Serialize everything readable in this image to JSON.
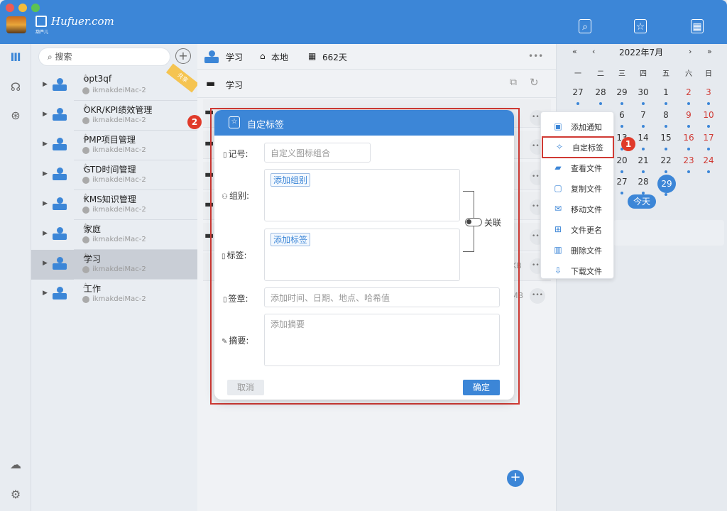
{
  "brand": {
    "logo_text": "Hufuer.com",
    "sub": "葫芦儿"
  },
  "colors": {
    "accent": "#3c86d7",
    "highlight": "#d03a34",
    "weekend": "#d03a34"
  },
  "sidebar": {
    "search_placeholder": "搜索",
    "items": [
      {
        "name": "opt3qf",
        "host": "ikmakdeiMac-2",
        "ribbon": "共享"
      },
      {
        "name": "OKR/KPI绩效管理",
        "host": "ikmakdeiMac-2"
      },
      {
        "name": "PMP项目管理",
        "host": "ikmakdeiMac-2"
      },
      {
        "name": "GTD时间管理",
        "host": "ikmakdeiMac-2"
      },
      {
        "name": "KMS知识管理",
        "host": "ikmakdeiMac-2"
      },
      {
        "name": "家庭",
        "host": "ikmakdeiMac-2"
      },
      {
        "name": "学习",
        "host": "ikmakdeiMac-2"
      },
      {
        "name": "工作",
        "host": "ikmakdeiMac-2"
      }
    ]
  },
  "main": {
    "breadcrumb_db": "学习",
    "breadcrumb_location": "本地",
    "breadcrumb_days": "662天",
    "folder_name": "学习",
    "row_sizes": [
      "KB",
      "MB"
    ]
  },
  "calendar": {
    "title": "2022年7月",
    "weekdays": [
      "一",
      "二",
      "三",
      "四",
      "五",
      "六",
      "日"
    ],
    "today_label": "今天",
    "visible_days": [
      "27",
      "28",
      "29",
      "30",
      "1",
      "2",
      "3",
      "6",
      "7",
      "8",
      "9",
      "10",
      "13",
      "14",
      "15",
      "16",
      "17",
      "20",
      "21",
      "22",
      "23",
      "24",
      "27",
      "28",
      "29",
      "30",
      "31"
    ]
  },
  "context_menu": [
    {
      "icon": "bell-icon",
      "label": "添加通知"
    },
    {
      "icon": "tag-icon",
      "label": "自定标签"
    },
    {
      "icon": "folder-open-icon",
      "label": "查看文件"
    },
    {
      "icon": "copy-icon",
      "label": "复制文件"
    },
    {
      "icon": "move-icon",
      "label": "移动文件"
    },
    {
      "icon": "rename-icon",
      "label": "文件更名"
    },
    {
      "icon": "trash-icon",
      "label": "删除文件"
    },
    {
      "icon": "download-icon",
      "label": "下载文件"
    }
  ],
  "annotations": {
    "badge1": "1",
    "badge2": "2"
  },
  "modal": {
    "title": "自定标签",
    "fields": {
      "code_label": "记号:",
      "code_placeholder": "自定义图标组合",
      "group_label": "组别:",
      "group_tag": "添加组别",
      "tag_label": "标签:",
      "tag_tag": "添加标签",
      "link_label": "关联",
      "stamp_label": "签章:",
      "stamp_placeholder": "添加时间、日期、地点、哈希值",
      "summary_label": "摘要:",
      "summary_placeholder": "添加摘要"
    },
    "cancel": "取消",
    "ok": "确定"
  }
}
